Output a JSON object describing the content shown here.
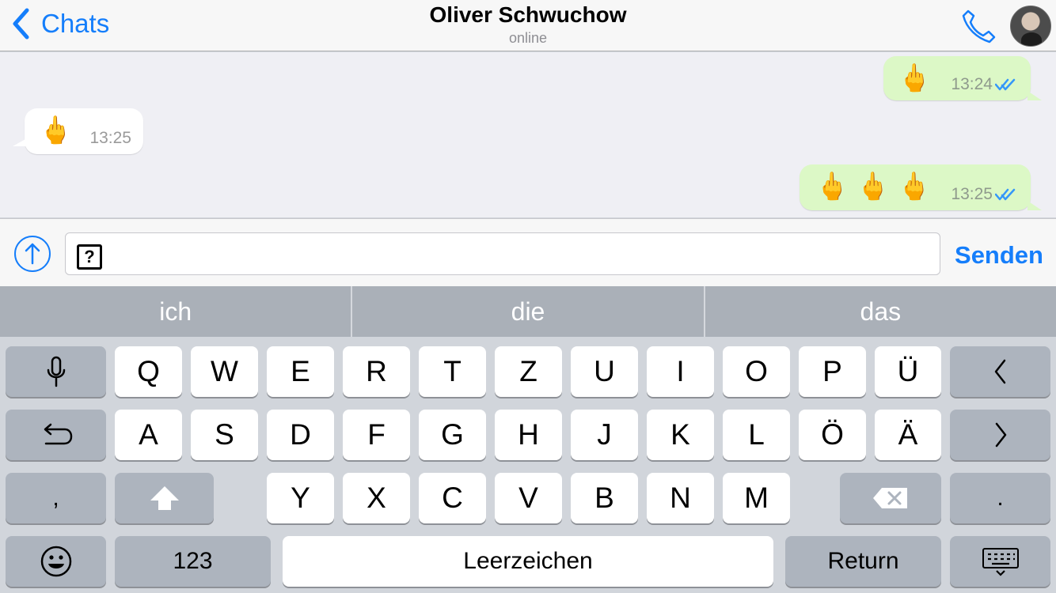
{
  "header": {
    "back_label": "Chats",
    "contact_name": "Oliver Schwuchow",
    "status": "online",
    "icons": [
      "chevron-left-icon",
      "phone-icon",
      "avatar"
    ]
  },
  "messages": [
    {
      "direction": "outgoing",
      "emoji": "🖕",
      "time": "13:24",
      "read_indicator": "double-check-icon"
    },
    {
      "direction": "incoming",
      "emoji": "🖕",
      "time": "13:25"
    },
    {
      "direction": "outgoing",
      "emoji": "🖕 🖕 🖕",
      "time": "13:25",
      "read_indicator": "double-check-icon"
    }
  ],
  "composer": {
    "text": "?",
    "send_label": "Senden",
    "attach_icon": "upload-arrow-icon"
  },
  "suggestions": [
    "ich",
    "die",
    "das"
  ],
  "keyboard": {
    "row1": [
      "Q",
      "W",
      "E",
      "R",
      "T",
      "Z",
      "U",
      "I",
      "O",
      "P",
      "Ü"
    ],
    "row2": [
      "A",
      "S",
      "D",
      "F",
      "G",
      "H",
      "J",
      "K",
      "L",
      "Ö",
      "Ä"
    ],
    "row3": [
      "Y",
      "X",
      "C",
      "V",
      "B",
      "N",
      "M"
    ],
    "comma": ",",
    "period": ".",
    "numbers_label": "123",
    "space_label": "Leerzeichen",
    "return_label": "Return",
    "icons": [
      "microphone-icon",
      "undo-icon",
      "shift-icon",
      "backspace-icon",
      "emoji-icon",
      "keyboard-dismiss-icon",
      "chevron-left-icon",
      "chevron-right-icon"
    ]
  },
  "colors": {
    "accent": "#157efb",
    "outgoing_bubble": "#dcf8c6",
    "chat_background": "#efeff4",
    "keyboard_background": "#d1d5db"
  }
}
